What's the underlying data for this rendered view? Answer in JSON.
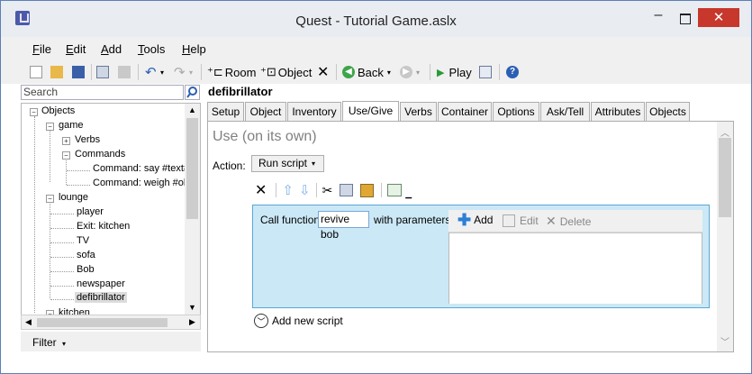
{
  "window": {
    "title": "Quest - Tutorial Game.aslx"
  },
  "menu": [
    {
      "label": "File",
      "accel": "F"
    },
    {
      "label": "Edit",
      "accel": "E"
    },
    {
      "label": "Add",
      "accel": "A"
    },
    {
      "label": "Tools",
      "accel": "T"
    },
    {
      "label": "Help",
      "accel": "H"
    }
  ],
  "toolbar": {
    "room": "Room",
    "object": "Object",
    "back": "Back",
    "play": "Play"
  },
  "left": {
    "search_placeholder": "Search",
    "filter": "Filter",
    "tree": [
      {
        "label": "Objects"
      },
      {
        "label": "game"
      },
      {
        "label": "Verbs"
      },
      {
        "label": "Commands"
      },
      {
        "label": "Command: say #text#"
      },
      {
        "label": "Command: weigh #object#"
      },
      {
        "label": "lounge"
      },
      {
        "label": "player"
      },
      {
        "label": "Exit: kitchen"
      },
      {
        "label": "TV"
      },
      {
        "label": "sofa"
      },
      {
        "label": "Bob"
      },
      {
        "label": "newspaper"
      },
      {
        "label": "defibrillator"
      },
      {
        "label": "kitchen"
      }
    ]
  },
  "right": {
    "object_name": "defibrillator",
    "tabs": [
      "Setup",
      "Object",
      "Inventory",
      "Use/Give",
      "Verbs",
      "Container",
      "Options",
      "Ask/Tell",
      "Attributes",
      "Objects"
    ],
    "section_title": "Use (on its own)",
    "action_label": "Action:",
    "action_value": "Run script",
    "call_label": "Call function",
    "function_value": "revive bob",
    "with_params": "with parameters:",
    "param_add": "Add",
    "param_edit": "Edit",
    "param_delete": "Delete",
    "add_new_script": "Add new script"
  },
  "colors": {
    "script_bg": "#cbe8f6",
    "close_red": "#c7372c",
    "accent_blue": "#3b7dd8"
  }
}
